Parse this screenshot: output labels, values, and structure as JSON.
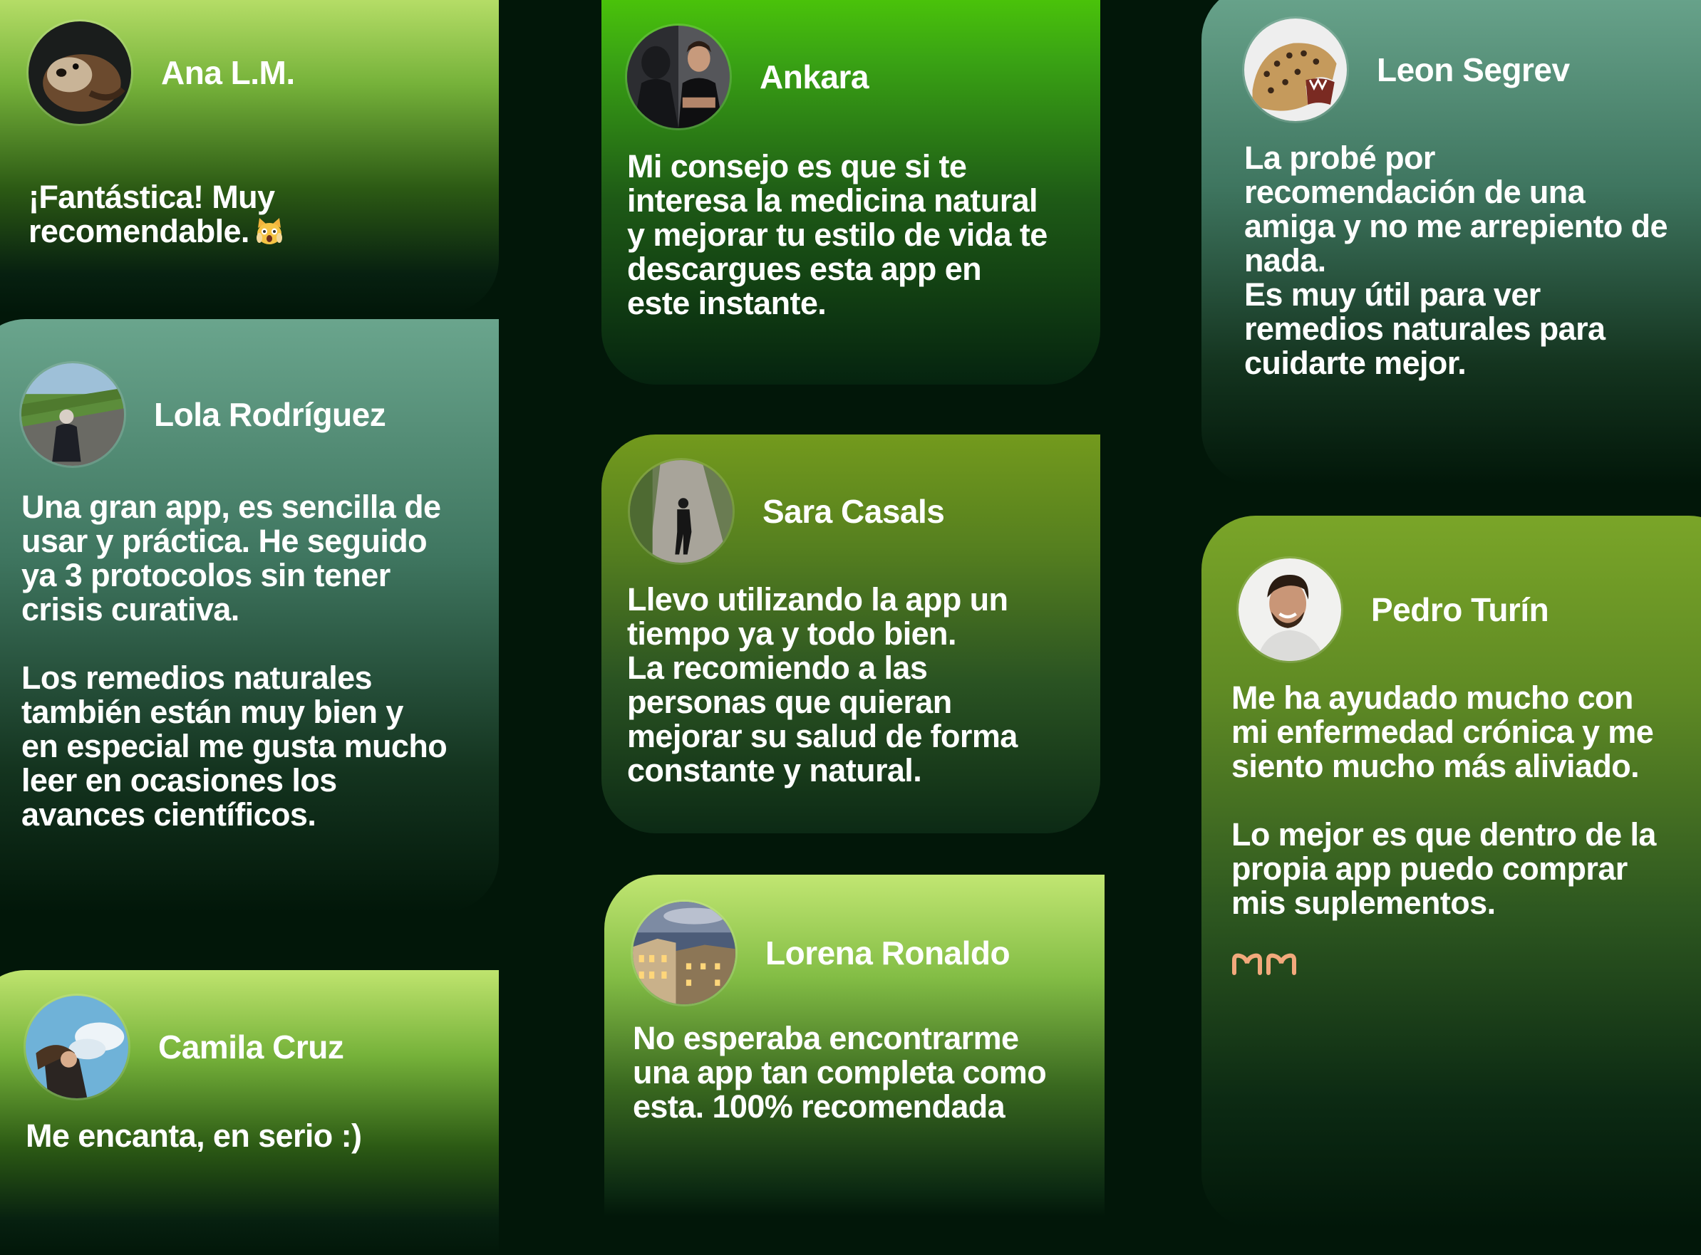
{
  "colors": {
    "page_background": "#021709",
    "text": "#ffffff",
    "lime_top": "#bfe46e",
    "bright_green_top": "#59e000",
    "teal_top": "#6aa58d",
    "olive_top": "#739a1d"
  },
  "testimonials": [
    {
      "name": "Ana L.M.",
      "avatar_icon": "sea-otter-photo",
      "text": "¡Fantástica! Muy\nrecomendable.",
      "emoji_icon": "shocked-cat-emoji"
    },
    {
      "name": "Lola Rodríguez",
      "avatar_icon": "person-on-country-road-photo",
      "text": "Una gran app, es sencilla de\nusar y práctica. He seguido\nya 3 protocolos sin tener\ncrisis curativa.\n\nLos remedios naturales\ntambién están muy bien y\nen especial me gusta mucho\nleer en ocasiones los\navances científicos."
    },
    {
      "name": "Camila Cruz",
      "avatar_icon": "woman-with-windblown-hair-photo",
      "text": "Me encanta, en serio :)"
    },
    {
      "name": "Ankara",
      "avatar_icon": "man-in-black-tshirt-photo",
      "text": "Mi consejo es que si te\ninteresa la medicina natural\ny mejorar tu estilo de vida te\ndescargues esta app en\neste instante."
    },
    {
      "name": "Sara Casals",
      "avatar_icon": "runner-on-path-photo",
      "text": "Llevo utilizando la app un\ntiempo ya y todo bien.\nLa recomiendo a las\npersonas que quieran\nmejorar su salud de forma\nconstante y natural."
    },
    {
      "name": "Lorena Ronaldo",
      "avatar_icon": "paris-rooftops-photo",
      "text": "No esperaba encontrarme\nuna app tan completa como\nesta. 100% recomendada"
    },
    {
      "name": "Leon Segrev",
      "avatar_icon": "roaring-jaguar-photo",
      "text": "La probé por\nrecomendación de una\namiga y no me arrepiento de\nnada.\nEs muy útil para ver\nremedios naturales para\ncuidarte mejor."
    },
    {
      "name": "Pedro Turín",
      "avatar_icon": "smiling-bearded-man-photo",
      "text": "Me ha ayudado mucho con\nmi enfermedad crónica y me\nsiento mucho más aliviado.\n\nLo mejor es que dentro de la\npropia app puedo comprar\nmis suplementos.",
      "emoji_icon": "heart-hands-emoji"
    }
  ]
}
